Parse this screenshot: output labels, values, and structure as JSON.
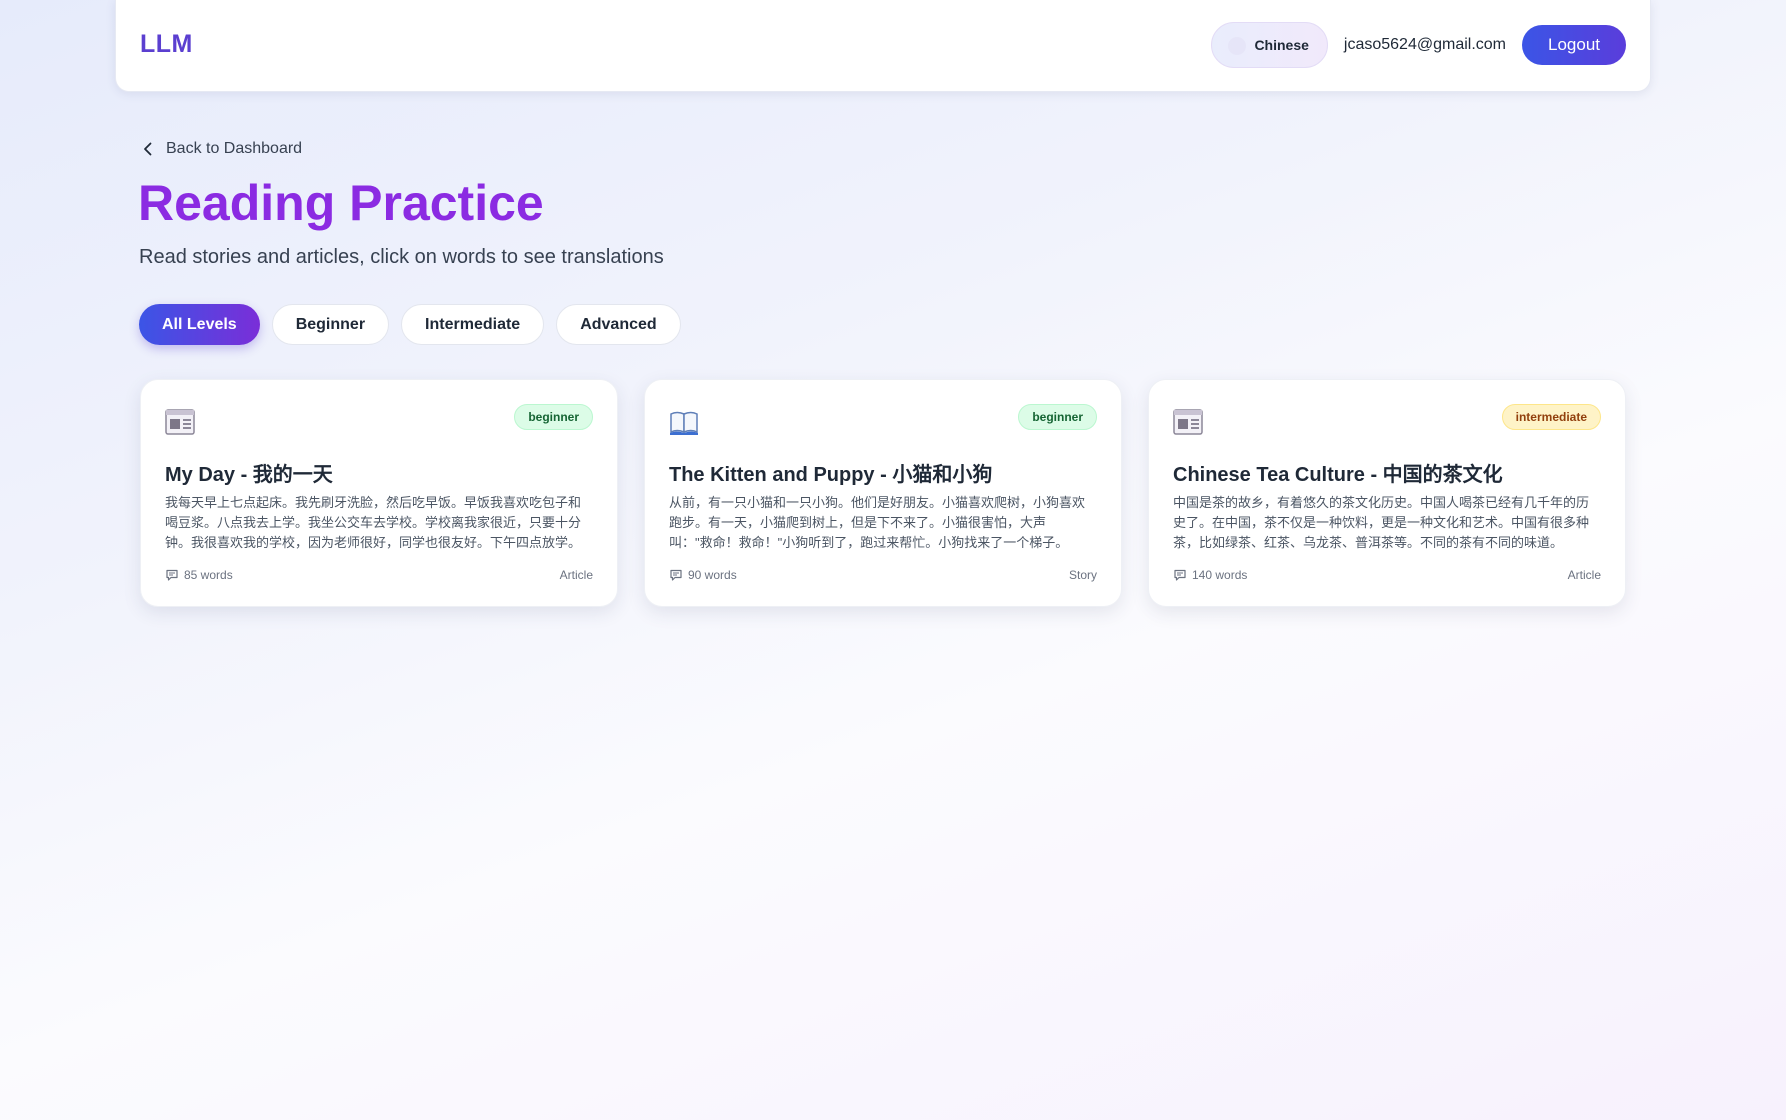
{
  "header": {
    "logo": "LLM",
    "language": "Chinese",
    "user_email": "jcaso5624@gmail.com",
    "logout_label": "Logout"
  },
  "page": {
    "back_label": "Back to Dashboard",
    "title": "Reading Practice",
    "subtitle": "Read stories and articles, click on words to see translations"
  },
  "filters": {
    "all": "All Levels",
    "beginner": "Beginner",
    "intermediate": "Intermediate",
    "advanced": "Advanced",
    "active": "All Levels"
  },
  "cards": [
    {
      "icon": "newspaper-icon",
      "level": "beginner",
      "title": "My Day - 我的一天",
      "excerpt": "我每天早上七点起床。我先刷牙洗脸，然后吃早饭。早饭我喜欢吃包子和喝豆浆。八点我去上学。我坐公交车去学校。学校离我家很近，只要十分钟。我很喜欢我的学校，因为老师很好，同学也很友好。下午四点放学。",
      "word_count": "85 words",
      "type": "Article"
    },
    {
      "icon": "open-book-icon",
      "level": "beginner",
      "title": "The Kitten and Puppy - 小猫和小狗",
      "excerpt": "从前，有一只小猫和一只小狗。他们是好朋友。小猫喜欢爬树，小狗喜欢跑步。有一天，小猫爬到树上，但是下不来了。小猫很害怕，大声叫：\"救命！救命！\"小狗听到了，跑过来帮忙。小狗找来了一个梯子。",
      "word_count": "90 words",
      "type": "Story"
    },
    {
      "icon": "newspaper-icon",
      "level": "intermediate",
      "title": "Chinese Tea Culture - 中国的茶文化",
      "excerpt": "中国是茶的故乡，有着悠久的茶文化历史。中国人喝茶已经有几千年的历史了。在中国，茶不仅是一种饮料，更是一种文化和艺术。中国有很多种茶，比如绿茶、红茶、乌龙茶、普洱茶等。不同的茶有不同的味道。",
      "word_count": "140 words",
      "type": "Article"
    }
  ],
  "colors": {
    "accent_blue": "#3b55e6",
    "accent_purple": "#8b2be2",
    "beginner_badge_bg": "#dcfce7",
    "intermediate_badge_bg": "#fef3c7"
  }
}
